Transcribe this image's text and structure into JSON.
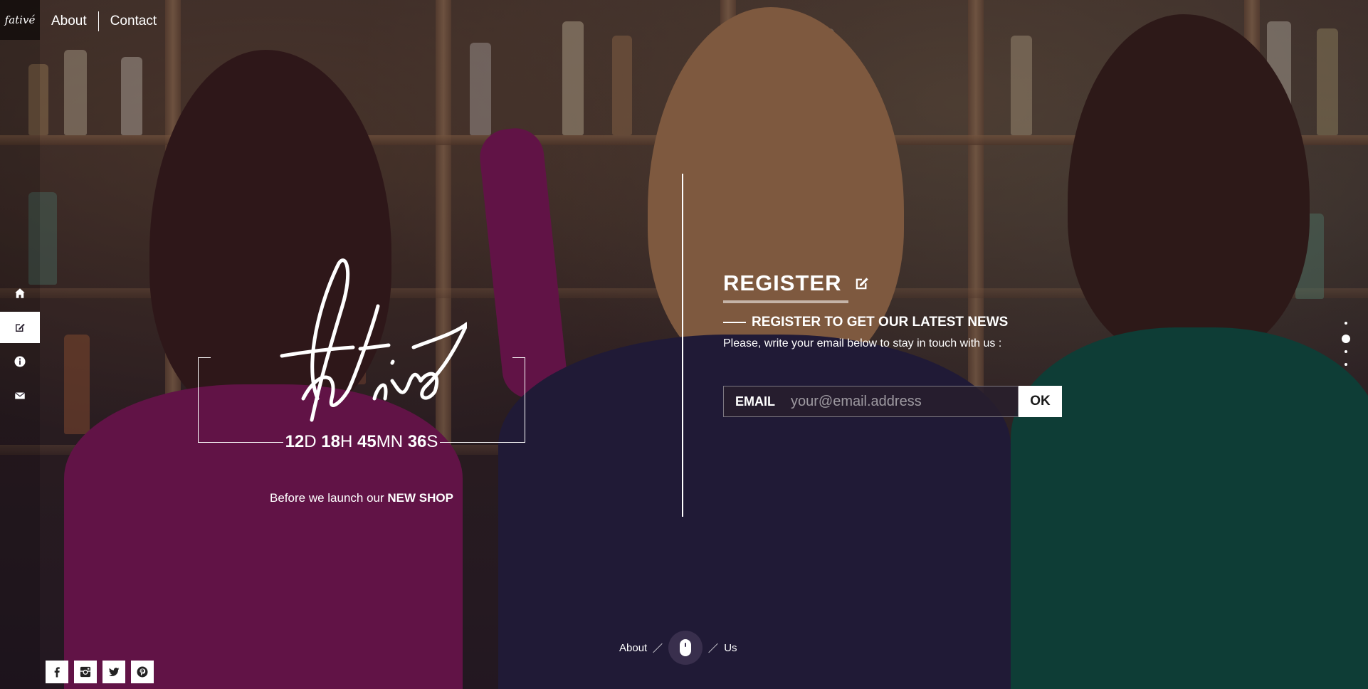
{
  "brand": {
    "logo_text": "fativé"
  },
  "nav": {
    "links": [
      "About",
      "Contact"
    ]
  },
  "rail": {
    "icons": [
      "home-icon",
      "edit-icon",
      "info-icon",
      "mail-icon"
    ],
    "active": "edit-icon"
  },
  "countdown": {
    "days": "12",
    "days_unit": "D",
    "hours": "18",
    "hours_unit": "H",
    "minutes": "45",
    "minutes_unit": "MN",
    "seconds": "36",
    "seconds_unit": "S"
  },
  "tagline": {
    "prefix": "Before we launch our",
    "highlight": "NEW SHOP"
  },
  "register": {
    "title": "REGISTER",
    "subtitle": "REGISTER TO GET OUR LATEST NEWS",
    "description": "Please, write your email below to stay in touch with us :",
    "email_label": "EMAIL",
    "email_placeholder": "your@email.address",
    "ok_label": "OK"
  },
  "scroll": {
    "left": "About",
    "right": "Us"
  },
  "social": [
    "facebook-icon",
    "instagram-icon",
    "twitter-icon",
    "pinterest-icon"
  ],
  "colors": {
    "accent": "#ffffff",
    "dark_panel": "#281e2d"
  }
}
